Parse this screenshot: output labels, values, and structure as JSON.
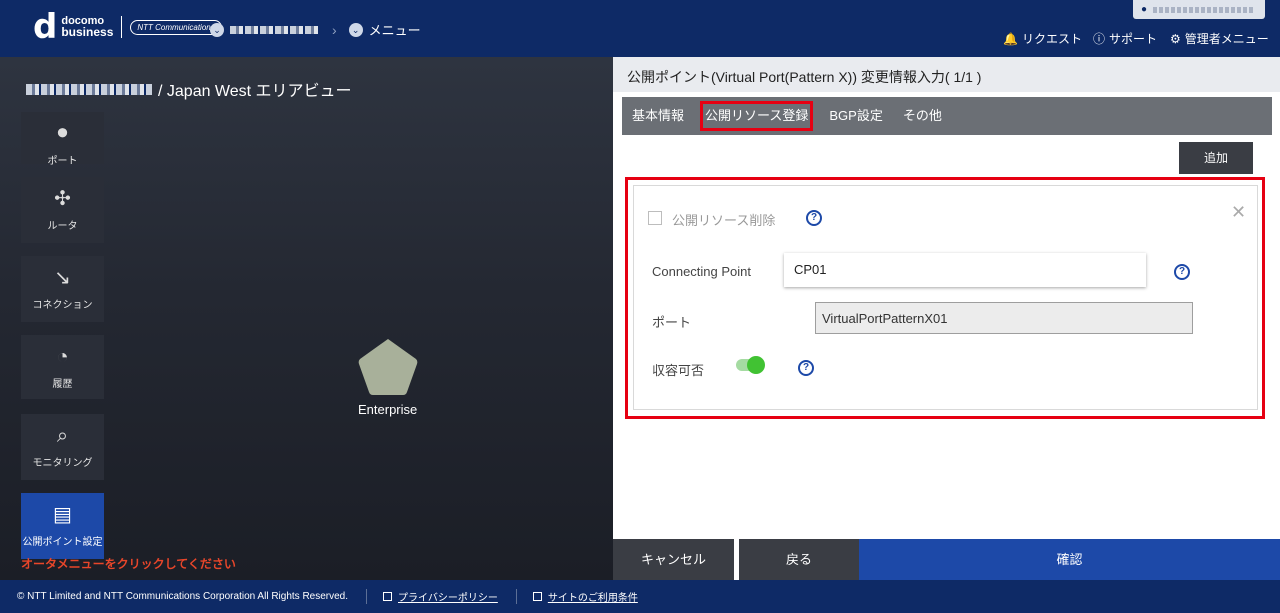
{
  "header": {
    "logo_top": "docomo",
    "logo_bottom": "business",
    "logo_ntt": "NTT Communications",
    "breadcrumb_last": "メニュー",
    "nav": [
      "リクエスト",
      "サポート",
      "管理者メニュー"
    ]
  },
  "area": {
    "title_suffix": "/ Japan West エリアビュー"
  },
  "sidebar": {
    "items": [
      {
        "label": "ポート",
        "icon": "port-icon"
      },
      {
        "label": "ルータ",
        "icon": "router-icon"
      },
      {
        "label": "コネクション",
        "icon": "connection-icon"
      },
      {
        "label": "履歴",
        "icon": "history-icon"
      },
      {
        "label": "モニタリング",
        "icon": "monitoring-icon"
      },
      {
        "label": "公開ポイント設定",
        "icon": "monitor-icon"
      }
    ]
  },
  "canvas": {
    "node_label": "Enterprise",
    "hint": "オータメニューをクリックしてください"
  },
  "panel": {
    "title": "公開ポイント(Virtual Port(Pattern X)) 変更情報入力( 1/1 )",
    "tabs": [
      "基本情報",
      "公開リソース登録",
      "BGP設定",
      "その他"
    ],
    "add_label": "追加",
    "delete_label": "公開リソース削除",
    "cp_label": "Connecting Point",
    "cp_value": "CP01",
    "port_label": "ポート",
    "port_value": "VirtualPortPatternX01",
    "acc_label": "収容可否"
  },
  "buttons": {
    "cancel": "キャンセル",
    "back": "戻る",
    "confirm": "確認"
  },
  "footer": {
    "copyright": "© NTT Limited and NTT Communications Corporation All Rights Reserved.",
    "privacy": "プライバシーポリシー",
    "terms": "サイトのご利用条件"
  },
  "colors": {
    "header_bg": "#0e2a66",
    "accent": "#1d49a8",
    "highlight": "#e60012",
    "toggle": "#41c233"
  }
}
